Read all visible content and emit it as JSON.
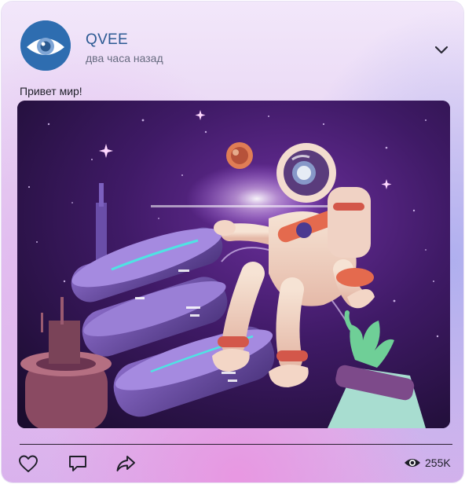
{
  "post": {
    "author": "QVEE",
    "time": "два часа назад",
    "text": "Привет мир!",
    "image_alt": "Астронавт в космосе рядом с космической станцией"
  },
  "stats": {
    "views": "255K"
  },
  "icons": {
    "avatar": "eye-logo",
    "menu": "chevron-down-icon",
    "like": "heart-icon",
    "comment": "comment-icon",
    "share": "share-icon",
    "views": "eye-icon"
  },
  "colors": {
    "author": "#2c5a93",
    "time": "#676b80",
    "avatar_bg": "#2e6db0",
    "icon": "#1e1e28"
  }
}
